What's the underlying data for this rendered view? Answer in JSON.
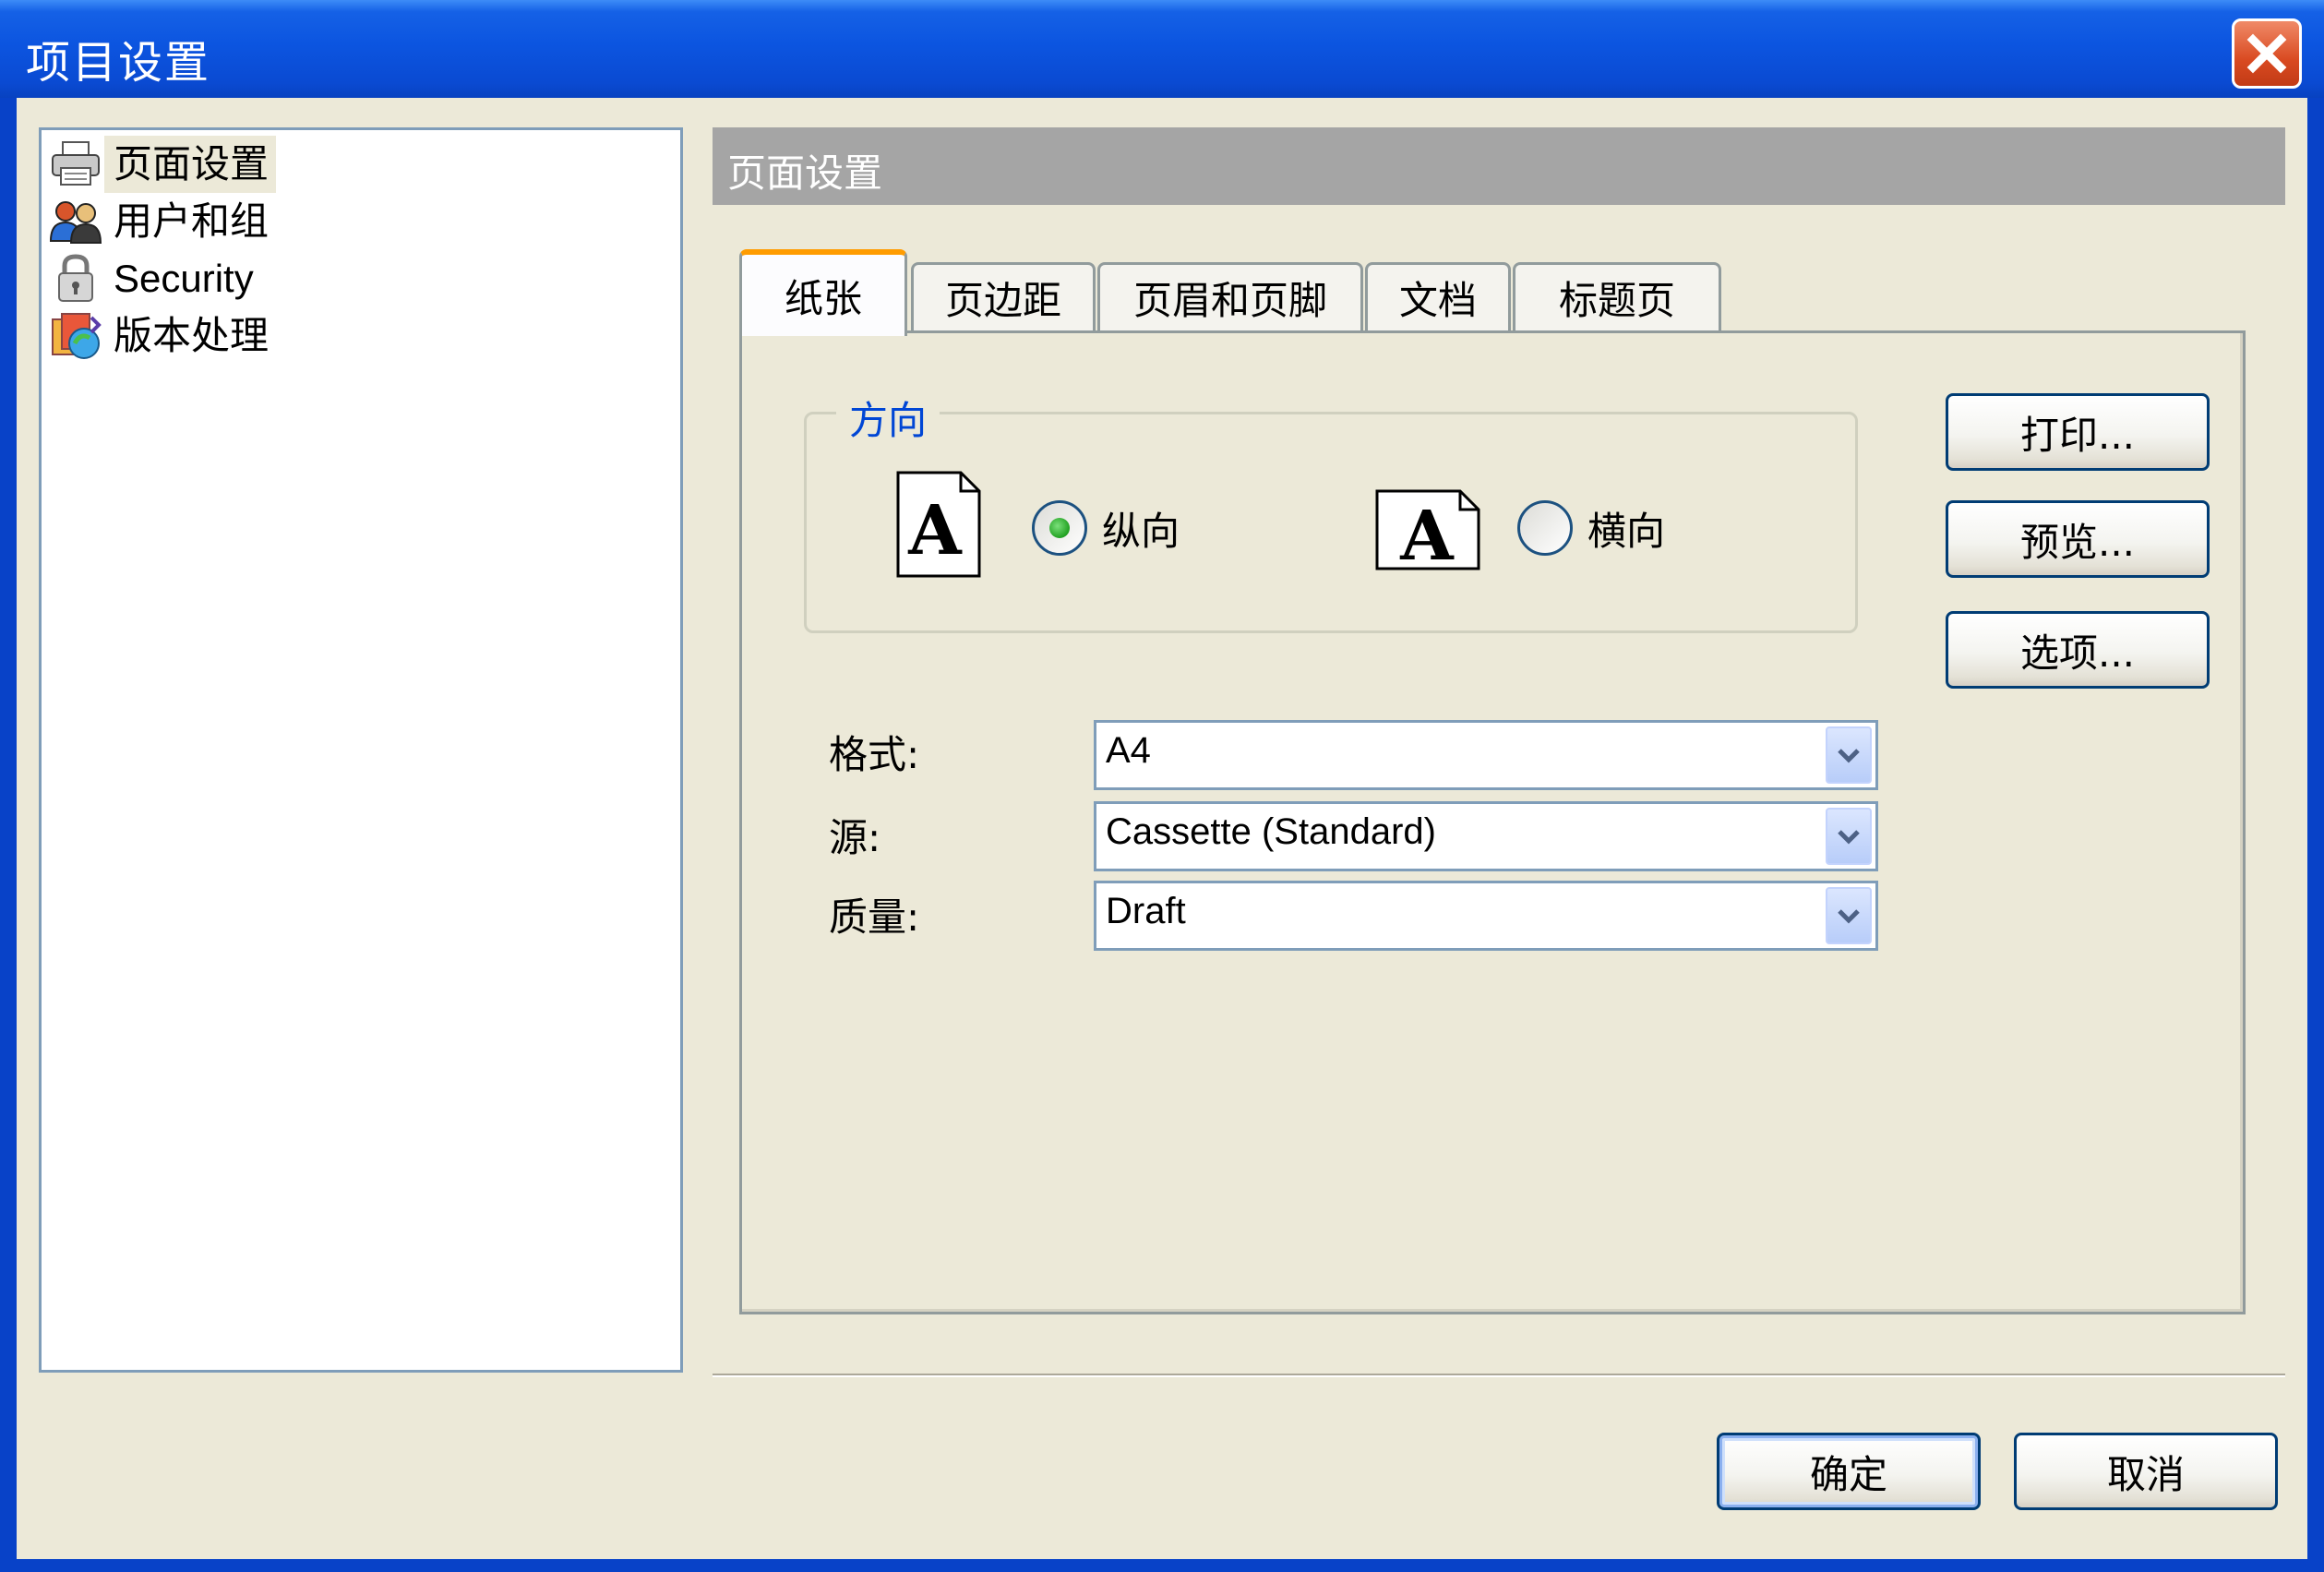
{
  "window": {
    "title": "项目设置"
  },
  "tree": {
    "items": [
      {
        "label": "页面设置",
        "icon": "printer-icon",
        "selected": true
      },
      {
        "label": "用户和组",
        "icon": "users-icon",
        "selected": false
      },
      {
        "label": "Security",
        "icon": "lock-icon",
        "selected": false
      },
      {
        "label": "版本处理",
        "icon": "version-icon",
        "selected": false
      }
    ]
  },
  "panel": {
    "header": "页面设置"
  },
  "tabs": [
    {
      "label": "纸张",
      "active": true
    },
    {
      "label": "页边距",
      "active": false
    },
    {
      "label": "页眉和页脚",
      "active": false
    },
    {
      "label": "文档",
      "active": false
    },
    {
      "label": "标题页",
      "active": false
    }
  ],
  "orientation": {
    "title": "方向",
    "portrait_label": "纵向",
    "landscape_label": "横向",
    "selected": "portrait",
    "page_icon_letter": "A"
  },
  "side_buttons": {
    "print": "打印...",
    "preview": "预览...",
    "options": "选项..."
  },
  "fields": {
    "format": {
      "label": "格式:",
      "value": "A4"
    },
    "source": {
      "label": "源:",
      "value": "Cassette (Standard)"
    },
    "quality": {
      "label": "质量:",
      "value": "Draft"
    }
  },
  "footer": {
    "ok": "确定",
    "cancel": "取消"
  },
  "colors": {
    "titlebar": "#0c55e0",
    "radio_dot": "#21a121",
    "tab_highlight": "#ff9c00",
    "group_title": "#0046d5"
  }
}
